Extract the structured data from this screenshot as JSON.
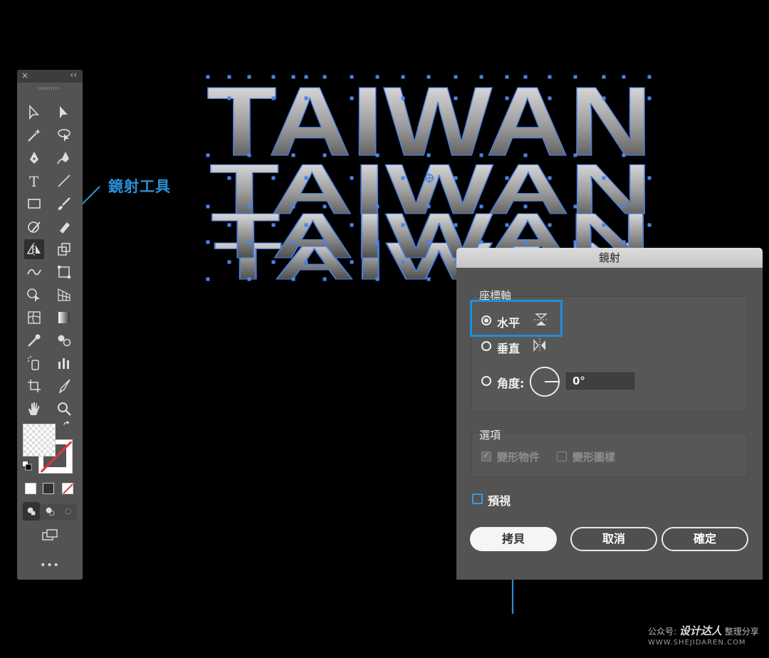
{
  "callout": {
    "label": "鏡射工具"
  },
  "artwork": {
    "word": "TAIWAN"
  },
  "dialog": {
    "title": "鏡射",
    "axis_group_label": "座標軸",
    "options": [
      {
        "label": "水平",
        "selected": true
      },
      {
        "label": "垂直",
        "selected": false
      },
      {
        "label": "角度:",
        "selected": false
      }
    ],
    "angle_value": "0°",
    "options_group_label": "選項",
    "transform_objects_label": "變形物件",
    "transform_objects_checked": true,
    "transform_patterns_label": "變形圖樣",
    "transform_patterns_checked": false,
    "preview_label": "預視",
    "preview_checked": false,
    "copy_button": "拷貝",
    "cancel_button": "取消",
    "ok_button": "確定"
  },
  "toolbar": {
    "close_glyph": "×",
    "collapse_glyph": "‹‹",
    "more_glyph": "•••"
  },
  "watermark": {
    "prefix": "公众号:",
    "brand": "设计达人",
    "suffix": "整理分享",
    "url": "WWW.SHEJIDAREN.COM"
  },
  "colors": {
    "accent": "#2a8fd6",
    "panel": "#535353",
    "background": "#000000"
  }
}
